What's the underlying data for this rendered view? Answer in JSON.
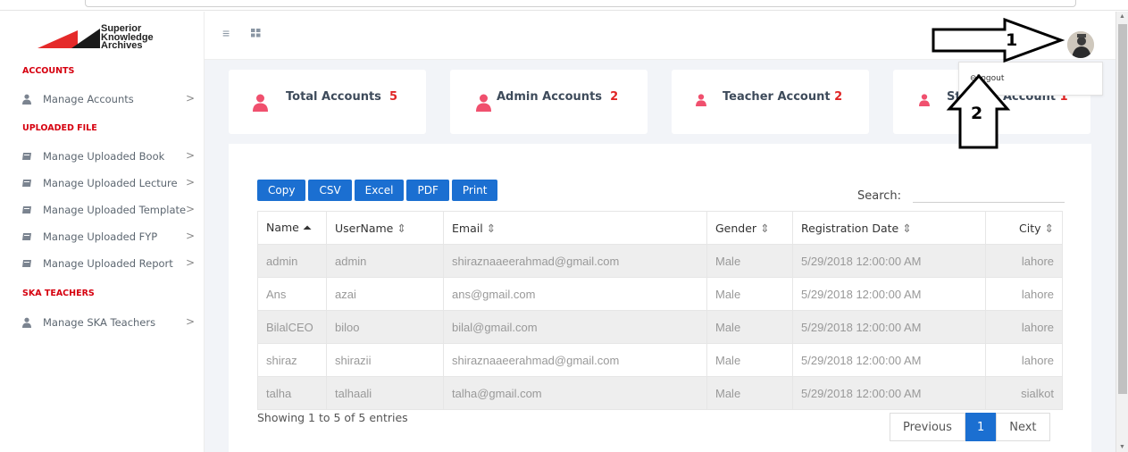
{
  "brand": {
    "line1": "Superior",
    "line2": "Knowledge",
    "line3": "Archives"
  },
  "sidebar": {
    "sections": [
      {
        "title": "ACCOUNTS",
        "items": [
          {
            "label": "Manage Accounts",
            "icon": "user-icon"
          }
        ]
      },
      {
        "title": "UPLOADED FILE",
        "items": [
          {
            "label": "Manage Uploaded Book",
            "icon": "book-icon"
          },
          {
            "label": "Manage Uploaded Lecture",
            "icon": "book-icon"
          },
          {
            "label": "Manage Uploaded Template",
            "icon": "book-icon"
          },
          {
            "label": "Manage Uploaded FYP",
            "icon": "book-icon"
          },
          {
            "label": "Manage Uploaded Report",
            "icon": "book-icon"
          }
        ]
      },
      {
        "title": "SKA TEACHERS",
        "items": [
          {
            "label": "Manage SKA Teachers",
            "icon": "user-icon"
          }
        ]
      }
    ],
    "chevron": ">"
  },
  "header": {
    "menu_icon": "≡",
    "dropdown_item": "Logout"
  },
  "stats": [
    {
      "label": "Total Accounts",
      "value": "5"
    },
    {
      "label": "Admin Accounts",
      "value": "2"
    },
    {
      "label": "Teacher Account",
      "value": "2"
    },
    {
      "label": "Student Account",
      "value": "1"
    }
  ],
  "toolbar": {
    "buttons": [
      "Copy",
      "CSV",
      "Excel",
      "PDF",
      "Print"
    ],
    "search_label": "Search:"
  },
  "table": {
    "columns": [
      "Name",
      "UserName",
      "Email",
      "Gender",
      "Registration Date",
      "City"
    ],
    "rows": [
      [
        "admin",
        "admin",
        "shiraznaaeerahmad@gmail.com",
        "Male",
        "5/29/2018 12:00:00 AM",
        "lahore"
      ],
      [
        "Ans",
        "azai",
        "ans@gmail.com",
        "Male",
        "5/29/2018 12:00:00 AM",
        "lahore"
      ],
      [
        "BilalCEO",
        "biloo",
        "bilal@gmail.com",
        "Male",
        "5/29/2018 12:00:00 AM",
        "lahore"
      ],
      [
        "shiraz",
        "shirazii",
        "shiraznaaeerahmad@gmail.com",
        "Male",
        "5/29/2018 12:00:00 AM",
        "lahore"
      ],
      [
        "talha",
        "talhaali",
        "talha@gmail.com",
        "Male",
        "5/29/2018 12:00:00 AM",
        "sialkot"
      ]
    ]
  },
  "footer": {
    "info": "Showing 1 to 5 of 5 entries",
    "previous": "Previous",
    "page": "1",
    "next": "Next"
  },
  "annotations": {
    "one": "1",
    "two": "2"
  },
  "colors": {
    "accent": "#1b6fd1",
    "brand_red": "#e02525",
    "icon_pink": "#f0506e"
  }
}
